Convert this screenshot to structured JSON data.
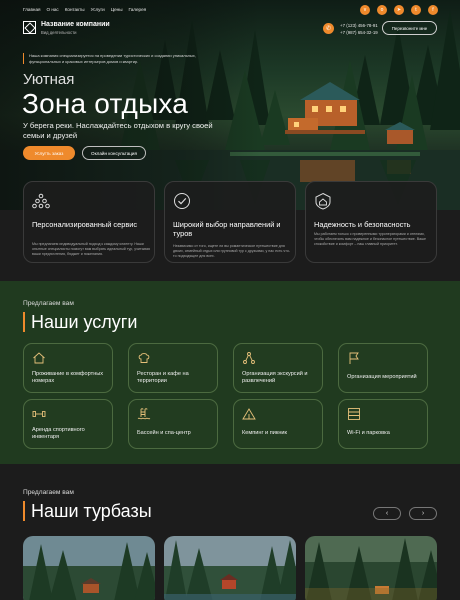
{
  "nav": [
    "Главная",
    "О нас",
    "Контакты",
    "Услуги",
    "Цены",
    "Галерея"
  ],
  "social": [
    "vk",
    "ok",
    "tg",
    "tw",
    "fb"
  ],
  "header": {
    "company": "Название компании",
    "subtitle": "Вид деятельности",
    "phone1": "+7 (123) 456-78-91",
    "phone2": "+7 (987) 654-32-19",
    "callback": "Перезвоните мне"
  },
  "hero": {
    "note": "Наша компания специализируется на проведении туристических и создании уникальных, функциональных и красивых интерьеров домов и квартир.",
    "kicker": "Уютная",
    "title": "Зона отдыха",
    "desc": "У берега реки. Наслаждайтесь отдыхом в кругу своей семьи и друзей",
    "order_btn": "Услугть заказ",
    "consult_btn": "Оклайн консультация"
  },
  "features": [
    {
      "icon": "people-pyramid-icon",
      "title": "Персонализированный сервис",
      "desc": "Мы предлагаем индивидуальный подход к каждому клиенту. Наши опытные специалисты помогут вам выбрать идеальный тур, учитывая ваши предпочтения, бюджет и пожелания."
    },
    {
      "icon": "check-circle-icon",
      "title": "Широкий выбор направлений и туров",
      "desc": "Независимо от того, ищете ли вы романтическое путешествие для двоих, семейный отдых или групповой тур с друзьями, у нас есть что-то подходящее для всех."
    },
    {
      "icon": "shield-house-icon",
      "title": "Надежность и безопасность",
      "desc": "Мы работаем только с проверенными туроператорами и отелями, чтобы обеспечить вам надежное и безопасное путешествие. Ваше спокойствие и комфорт – наш главный приоритет."
    }
  ],
  "services": {
    "kicker": "Предлагаем вам",
    "title": "Наши услуги",
    "items": [
      {
        "icon": "house-icon",
        "label": "Проживание в комфортных номерах"
      },
      {
        "icon": "chef-hat-icon",
        "label": "Ресторан и кафе на территории"
      },
      {
        "icon": "route-icon",
        "label": "Организация экскурсий и развлечений"
      },
      {
        "icon": "flag-icon",
        "label": "Организация мероприятий"
      },
      {
        "icon": "dumbbell-icon",
        "label": "Аренда спортивного инвентаря"
      },
      {
        "icon": "pool-icon",
        "label": "Бассейн и спа-центр"
      },
      {
        "icon": "tent-icon",
        "label": "Кемпинг и пикник"
      },
      {
        "icon": "wifi-parking-icon",
        "label": "Wi-Fi и парковка"
      }
    ]
  },
  "bases": {
    "kicker": "Предлагаем вам",
    "title": "Наши турбазы",
    "prev": "‹",
    "next": "›"
  },
  "colors": {
    "accent": "#ef8a2c",
    "green": "#203a1f",
    "dark": "#1c1c1c"
  }
}
